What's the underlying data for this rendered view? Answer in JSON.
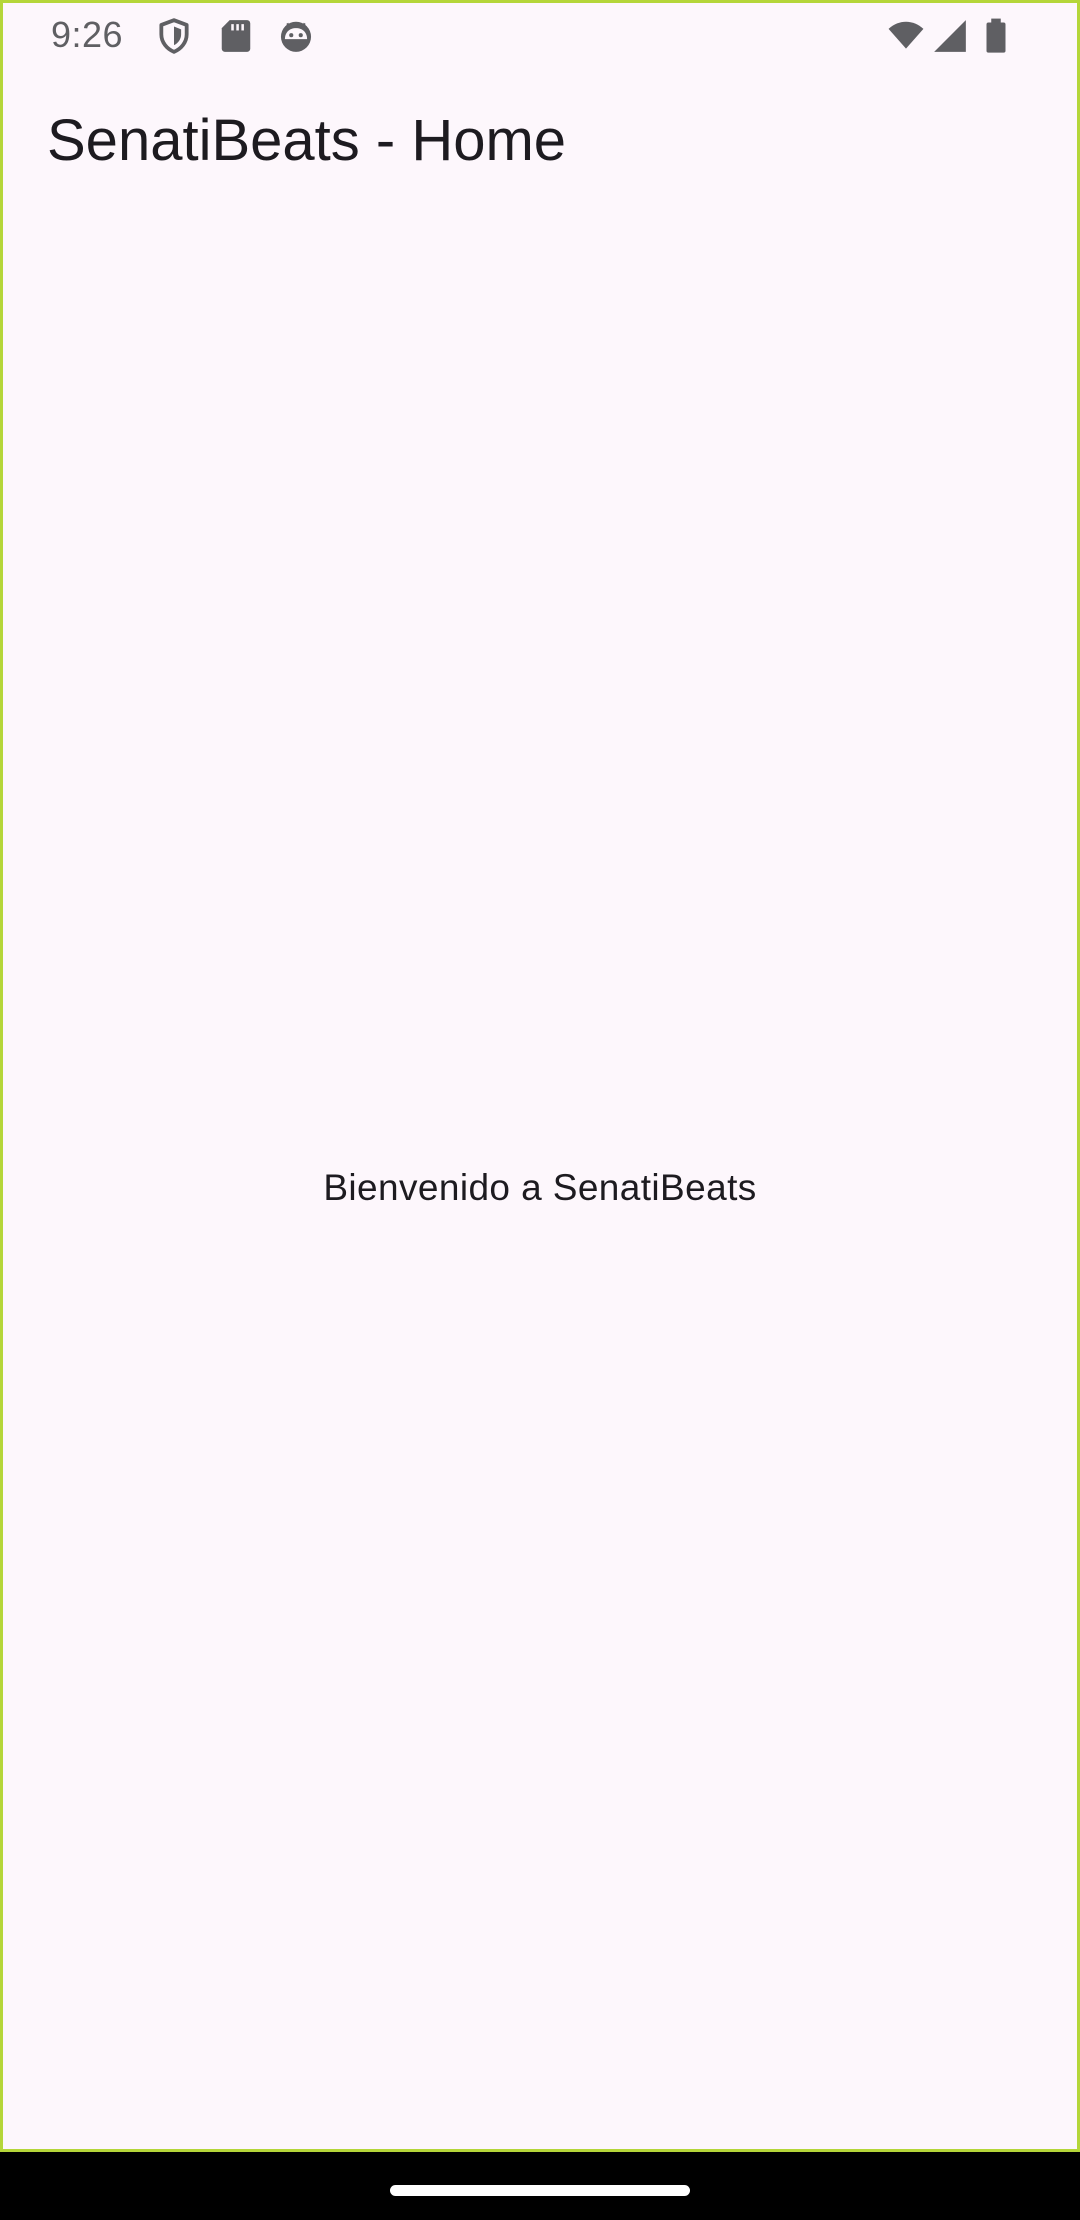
{
  "status_bar": {
    "time": "9:26",
    "icons_left": [
      "shield-icon",
      "sd-card-icon",
      "android-face-icon"
    ],
    "icons_right": [
      "wifi-icon",
      "cellular-signal-icon",
      "battery-icon"
    ]
  },
  "app_bar": {
    "title": "SenatiBeats - Home"
  },
  "main": {
    "welcome_text": "Bienvenido a SenatiBeats"
  },
  "colors": {
    "background": "#fdf7fc",
    "text": "#1d1b20",
    "status_icons": "#5f5f63",
    "frame_border": "#b5d63a",
    "nav_bar": "#000000",
    "home_handle": "#ffffff"
  }
}
